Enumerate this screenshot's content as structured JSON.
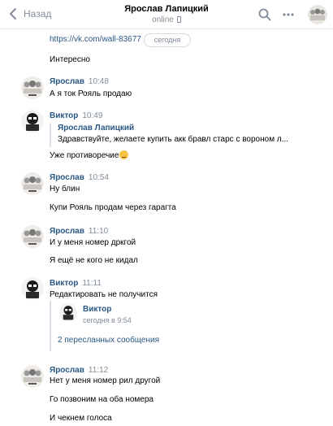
{
  "header": {
    "back_label": "Назад",
    "title": "Ярослав Лапицкий",
    "status": "online",
    "icons": [
      "chevron-left-icon",
      "search-icon",
      "more-icon",
      "avatar"
    ]
  },
  "date_pill": "сегодня",
  "messages": [
    {
      "text": "https://vk.com/wall-83677"
    },
    {
      "text": "Интересно"
    },
    {
      "author": "Ярослав",
      "time": "10:48",
      "lines": [
        "А я ток Рояль продаю"
      ]
    },
    {
      "author": "Виктор",
      "time": "10:49",
      "reply": {
        "author": "Ярослав Лапицкий",
        "text": "Здравствуйте, желаете купить акк бравл старс с вороном л..."
      },
      "lines": [
        "Уже противоречие"
      ]
    },
    {
      "author": "Ярослав",
      "time": "10:54",
      "lines": [
        "Ну блин",
        "Купи Рояль продам через гарагта"
      ]
    },
    {
      "author": "Ярослав",
      "time": "11:10",
      "lines": [
        "И у меня номер дркгой",
        "Я ещё не кого не кидал"
      ]
    },
    {
      "author": "Виктор",
      "time": "11:11",
      "lines": [
        "Редактировать не получится"
      ],
      "forwarded": {
        "author": "Виктор",
        "subtitle": "сегодня в 9:54",
        "count_label": "2 пересланных сообщения"
      }
    },
    {
      "author": "Ярослав",
      "time": "11:12",
      "lines": [
        "Нет у меня номер рил другой",
        "Го позвоним на оба номера",
        "И чекнем голоса"
      ]
    }
  ],
  "colors": {
    "link": "#2a5885",
    "muted": "#818c99",
    "border": "#e7e8ec"
  }
}
